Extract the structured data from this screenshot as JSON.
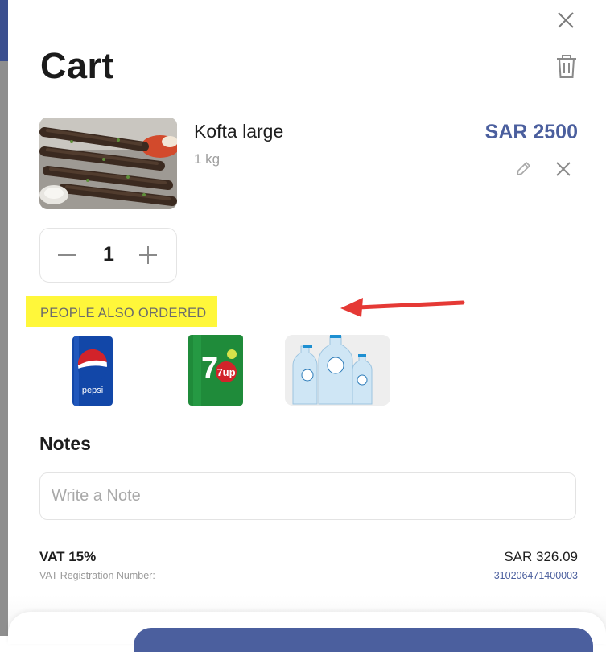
{
  "cart": {
    "title": "Cart"
  },
  "item": {
    "name": "Kofta large",
    "weight": "1 kg",
    "price": "SAR 2500",
    "quantity": "1"
  },
  "also_ordered": {
    "label": "PEOPLE ALSO ORDERED",
    "products": [
      {
        "icon": "pepsi-can",
        "brand_text": "pepsi"
      },
      {
        "icon": "7up-can",
        "brand_text": "7up"
      },
      {
        "icon": "water-bottles"
      }
    ]
  },
  "notes": {
    "title": "Notes",
    "placeholder": "Write a Note"
  },
  "vat": {
    "label": "VAT 15%",
    "amount": "SAR 326.09",
    "registration_label": "VAT Registration Number:",
    "registration_number": "310206471400003"
  },
  "colors": {
    "accent": "#4b5f9e",
    "highlight": "#fff73a",
    "arrow": "#e53935"
  }
}
